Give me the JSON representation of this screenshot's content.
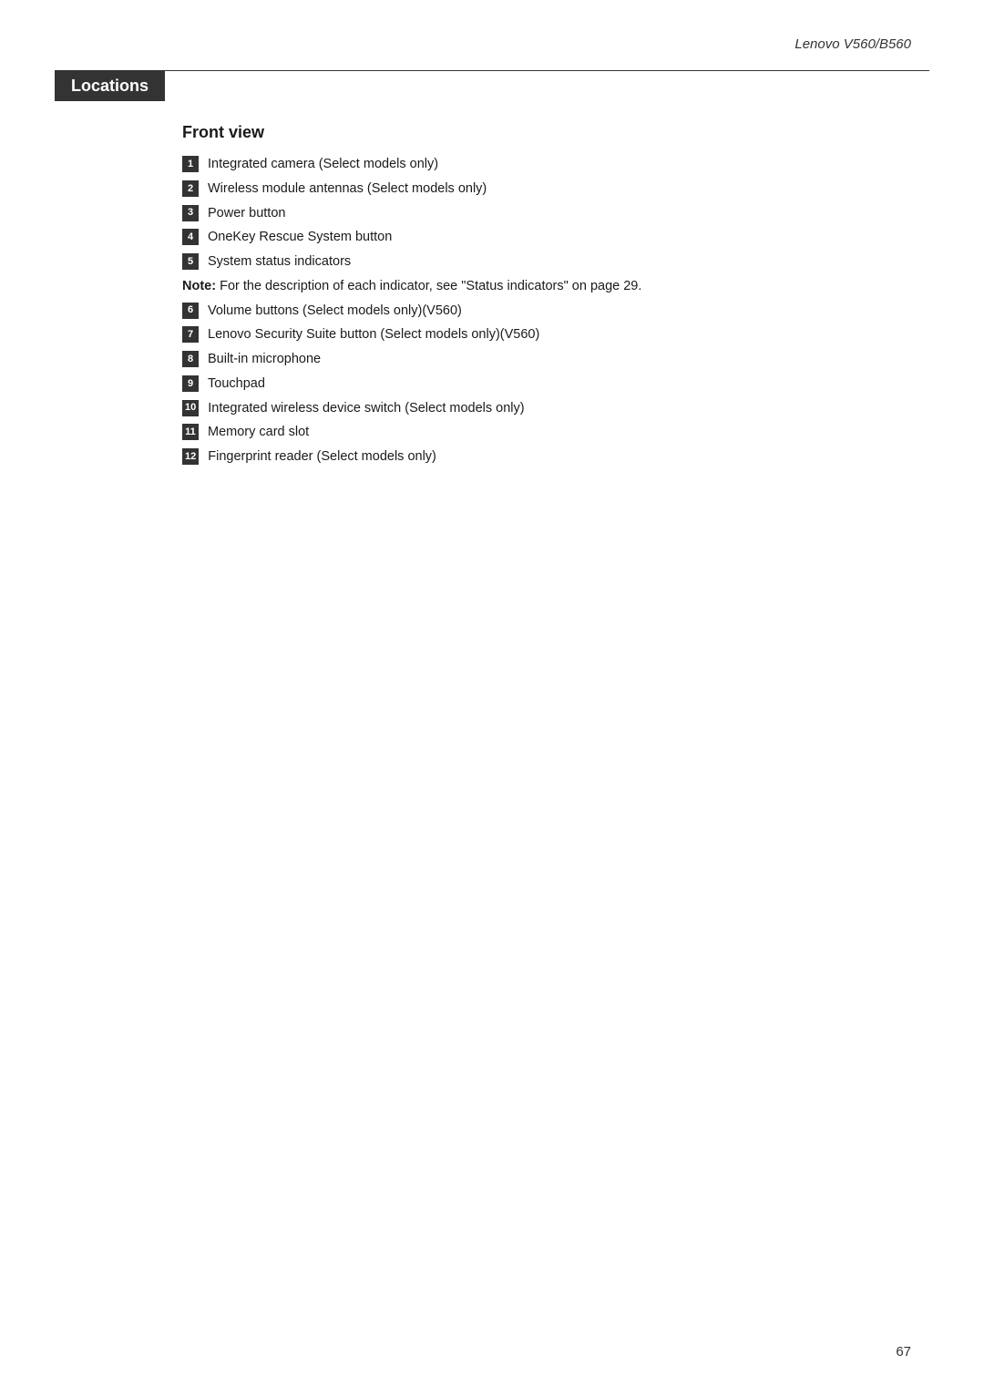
{
  "header": {
    "title": "Lenovo V560/B560"
  },
  "section": {
    "heading": "Locations",
    "subheading": "Front view",
    "items": [
      {
        "badge": "1",
        "text": "Integrated camera (Select models only)"
      },
      {
        "badge": "2",
        "text": "Wireless module antennas (Select models only)"
      },
      {
        "badge": "3",
        "text": "Power button"
      },
      {
        "badge": "4",
        "text": "OneKey Rescue System button"
      },
      {
        "badge": "5",
        "text": "System status indicators"
      }
    ],
    "note": "Note: For the description of each indicator, see “Status indicators” on page 29.",
    "items2": [
      {
        "badge": "6",
        "text": "Volume buttons (Select models only)(V560)"
      },
      {
        "badge": "7",
        "text": "Lenovo Security Suite button (Select models only)(V560)"
      },
      {
        "badge": "8",
        "text": "Built-in microphone"
      },
      {
        "badge": "9",
        "text": "Touchpad"
      },
      {
        "badge": "10",
        "text": "Integrated wireless device switch (Select models only)"
      },
      {
        "badge": "11",
        "text": "Memory card slot"
      },
      {
        "badge": "12",
        "text": "Fingerprint reader (Select models only)"
      }
    ]
  },
  "footer": {
    "page_number": "67"
  }
}
